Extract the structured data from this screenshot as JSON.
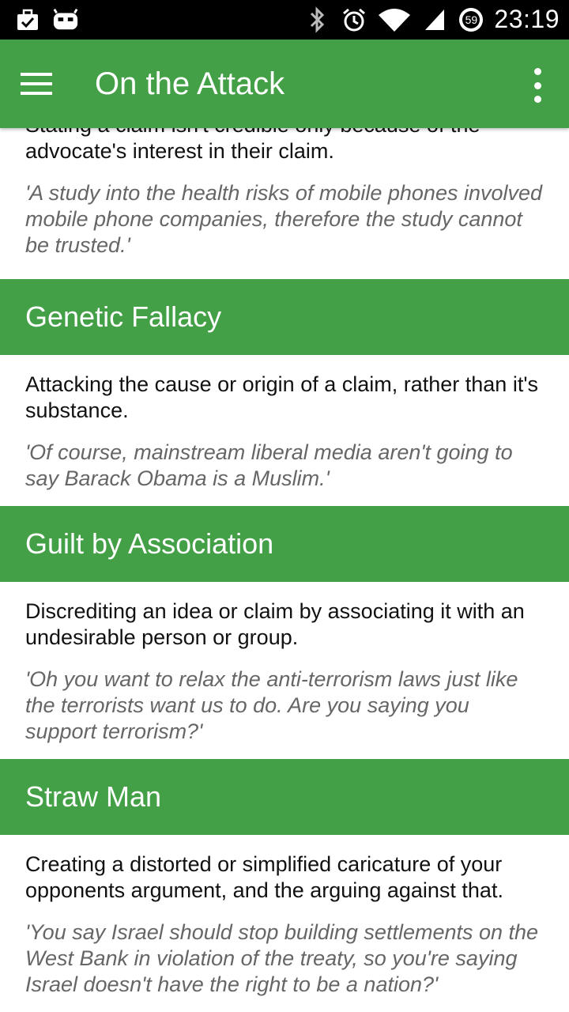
{
  "status_bar": {
    "time": "23:19",
    "notification_count": "59",
    "icons": [
      "briefcase-check-icon",
      "android-icon",
      "bluetooth-icon",
      "alarm-icon",
      "wifi-icon",
      "signal-icon"
    ]
  },
  "app_bar": {
    "title": "On the Attack",
    "menu_icon": "hamburger-menu-icon",
    "overflow_icon": "more-vert-icon"
  },
  "colors": {
    "primary": "#43a047",
    "example_text": "#666666"
  },
  "entries": [
    {
      "title": "",
      "description": "Stating a claim isn't credible only because of the advocate's interest in their claim.",
      "example": "'A study into the health risks of mobile phones involved mobile phone companies, therefore the study cannot be trusted.'"
    },
    {
      "title": "Genetic Fallacy",
      "description": "Attacking the cause or origin of a claim, rather than it's substance.",
      "example": "'Of course, mainstream liberal media aren't going to say Barack Obama is a Muslim.'"
    },
    {
      "title": "Guilt by Association",
      "description": "Discrediting an idea or claim by associating it with an undesirable person or group.",
      "example": "'Oh you want to relax the anti-terrorism laws just like the terrorists want us to do. Are you saying you support terrorism?'"
    },
    {
      "title": "Straw Man",
      "description": "Creating a distorted or simplified caricature of your opponents argument, and the arguing against that.",
      "example": "'You say Israel should stop building settlements on the West Bank in violation of the treaty, so you're saying Israel doesn't have the right to be a nation?'"
    }
  ]
}
